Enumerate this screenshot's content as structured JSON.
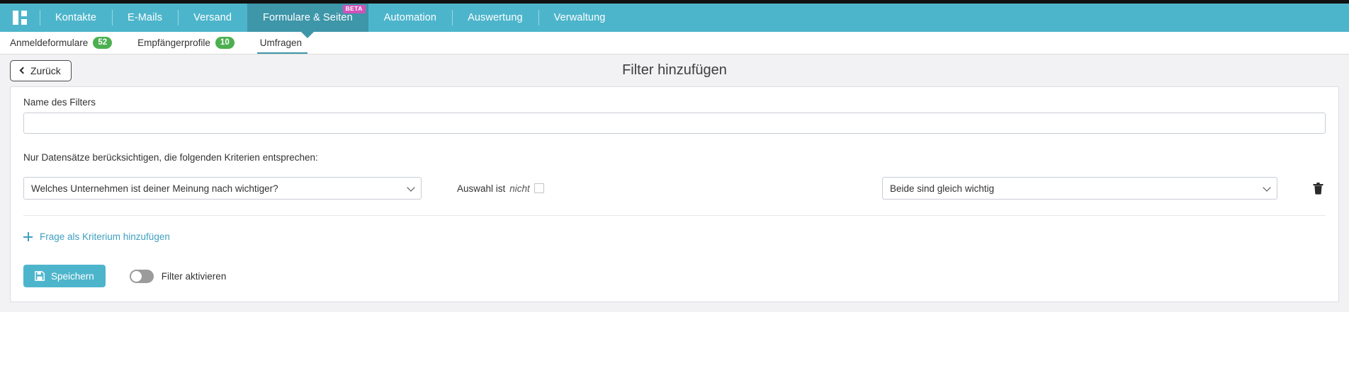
{
  "primary_nav": {
    "logo_icon": "grid-logo-icon",
    "items": [
      {
        "label": "Kontakte",
        "active": false
      },
      {
        "label": "E-Mails",
        "active": false
      },
      {
        "label": "Versand",
        "active": false
      },
      {
        "label": "Formulare & Seiten",
        "active": true,
        "badge": "BETA"
      },
      {
        "label": "Automation",
        "active": false
      },
      {
        "label": "Auswertung",
        "active": false
      },
      {
        "label": "Verwaltung",
        "active": false
      }
    ],
    "colors": {
      "bar": "#4db5cb",
      "active": "#3e96a9",
      "beta_badge": "#cf53b9"
    }
  },
  "secondary_nav": {
    "items": [
      {
        "label": "Anmeldeformulare",
        "count": "52",
        "active": false
      },
      {
        "label": "Empfängerprofile",
        "count": "10",
        "active": false
      },
      {
        "label": "Umfragen",
        "count": "",
        "active": true
      }
    ],
    "badge_color": "#4caf50"
  },
  "page_band": {
    "back_label": "Zurück",
    "title": "Filter hinzufügen"
  },
  "form": {
    "name_label": "Name des Filters",
    "name_value": "",
    "name_placeholder": "",
    "criteria_label": "Nur Datensätze berücksichtigen, die folgenden Kriterien entsprechen:",
    "rows": [
      {
        "question": "Welches Unternehmen ist deiner Meinung nach wichtiger?",
        "negate_prefix": "Auswahl ist",
        "negate_word": "nicht",
        "negate_checked": false,
        "value": "Beide sind gleich wichtig",
        "delete_icon": "trash-icon"
      }
    ],
    "add_criterion_label": "Frage als Kriterium hinzufügen",
    "save_label": "Speichern",
    "toggle_label": "Filter aktivieren",
    "toggle_on": false,
    "accent_color": "#4db5cb",
    "link_color": "#3e9fc0"
  }
}
